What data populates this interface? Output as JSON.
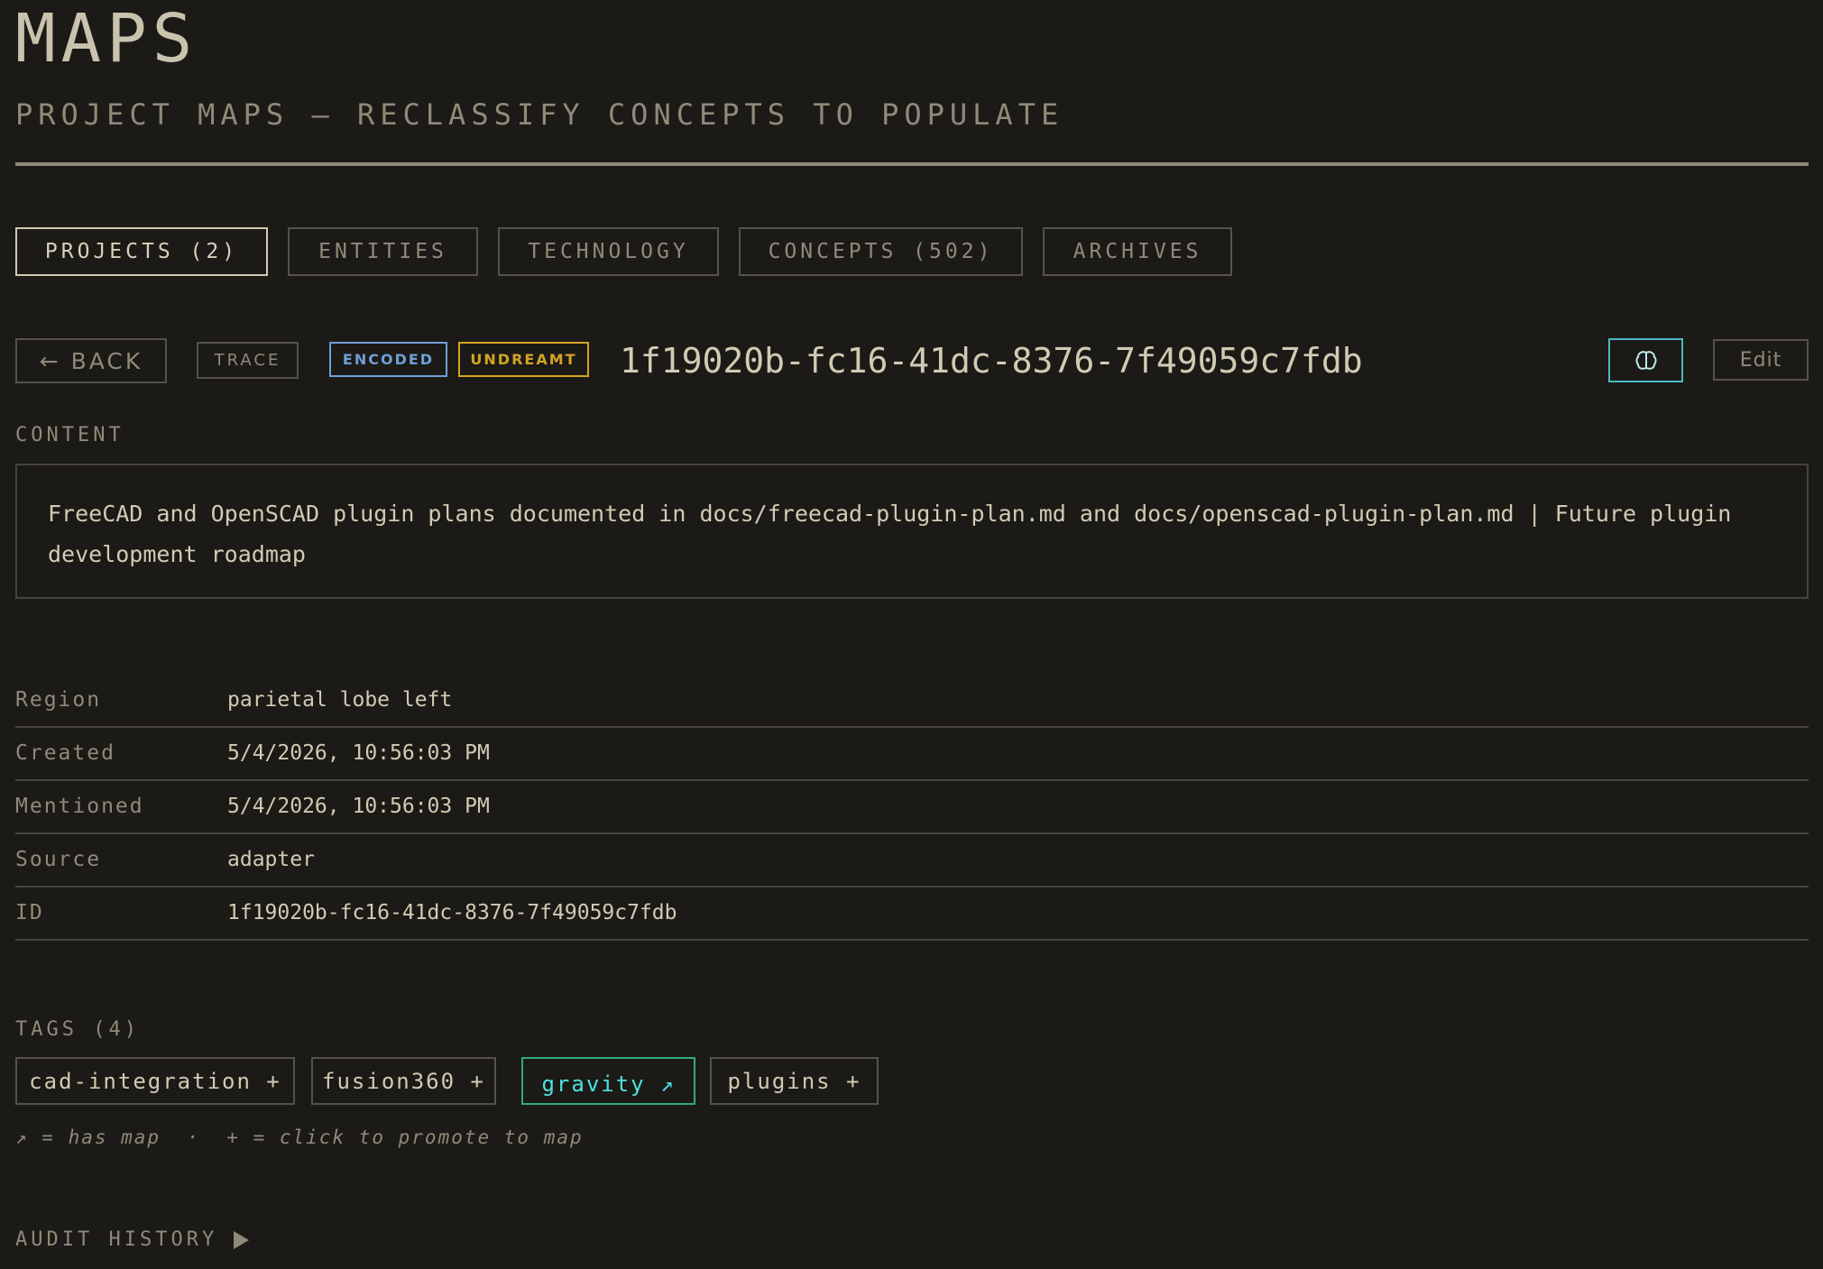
{
  "header": {
    "title": "MAPS",
    "subtitle": "PROJECT MAPS — RECLASSIFY CONCEPTS TO POPULATE"
  },
  "tabs": [
    {
      "label": "PROJECTS (2)",
      "active": true
    },
    {
      "label": "ENTITIES",
      "active": false
    },
    {
      "label": "TECHNOLOGY",
      "active": false
    },
    {
      "label": "CONCEPTS (502)",
      "active": false
    },
    {
      "label": "ARCHIVES",
      "active": false
    }
  ],
  "toolbar": {
    "back_label": "← BACK",
    "trace_label": "TRACE",
    "badge_encoded": "ENCODED",
    "badge_undreamt": "UNDREAMT",
    "entity_id": "1f19020b-fc16-41dc-8376-7f49059c7fdb",
    "brain_icon": "brain-icon",
    "edit_label": "Edit"
  },
  "content": {
    "label": "CONTENT",
    "text": "FreeCAD and OpenSCAD plugin plans documented in docs/freecad-plugin-plan.md and docs/openscad-plugin-plan.md | Future plugin development roadmap"
  },
  "meta": [
    {
      "key": "Region",
      "value": "parietal lobe left"
    },
    {
      "key": "Created",
      "value": "5/4/2026, 10:56:03 PM"
    },
    {
      "key": "Mentioned",
      "value": "5/4/2026, 10:56:03 PM"
    },
    {
      "key": "Source",
      "value": "adapter"
    },
    {
      "key": "ID",
      "value": "1f19020b-fc16-41dc-8376-7f49059c7fdb"
    }
  ],
  "tags": {
    "label": "TAGS (4)",
    "items": [
      {
        "label": "cad-integration +",
        "has_map": false
      },
      {
        "label": "fusion360 +",
        "has_map": false
      },
      {
        "label": "gravity ↗",
        "has_map": true
      },
      {
        "label": "plugins +",
        "has_map": false
      }
    ],
    "hint": "↗ = has map  ·  + = click to promote to map"
  },
  "audit": {
    "label": "AUDIT HISTORY",
    "icon": "play-icon"
  },
  "colors": {
    "background": "#1b1a16",
    "text": "#d1cbb4",
    "muted": "#8f8a79",
    "encoded": "#6f9fd6",
    "undreamt": "#d4a323",
    "has_map_border": "#2faa7e",
    "has_map_text": "#4fe1e0",
    "brain_accent": "#4fb6c4"
  }
}
